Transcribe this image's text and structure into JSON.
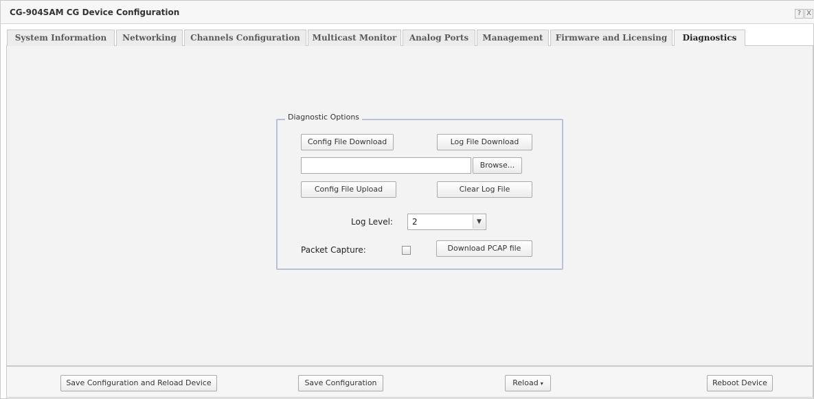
{
  "window": {
    "title": "CG-904SAM CG Device Configuration",
    "help_label": "?",
    "close_label": "X"
  },
  "tabs": [
    {
      "label": "System Information",
      "active": false
    },
    {
      "label": "Networking",
      "active": false
    },
    {
      "label": "Channels Configuration",
      "active": false
    },
    {
      "label": "Multicast Monitor",
      "active": false
    },
    {
      "label": "Analog Ports",
      "active": false
    },
    {
      "label": "Management",
      "active": false
    },
    {
      "label": "Firmware and Licensing",
      "active": false
    },
    {
      "label": "Diagnostics",
      "active": true
    }
  ],
  "diagnostics": {
    "legend": "Diagnostic Options",
    "config_file_download": "Config File Download",
    "log_file_download": "Log File Download",
    "file_path_value": "",
    "browse": "Browse...",
    "config_file_upload": "Config File Upload",
    "clear_log_file": "Clear Log File",
    "log_level_label": "Log Level:",
    "log_level_value": "2",
    "log_level_arrow": "▼",
    "packet_capture_label": "Packet Capture:",
    "packet_capture_checked": false,
    "download_pcap": "Download PCAP file"
  },
  "footer": {
    "save_and_reload": "Save Configuration and Reload Device",
    "save": "Save Configuration",
    "reload": "Reload",
    "reload_caret": "▾",
    "reboot": "Reboot Device"
  }
}
